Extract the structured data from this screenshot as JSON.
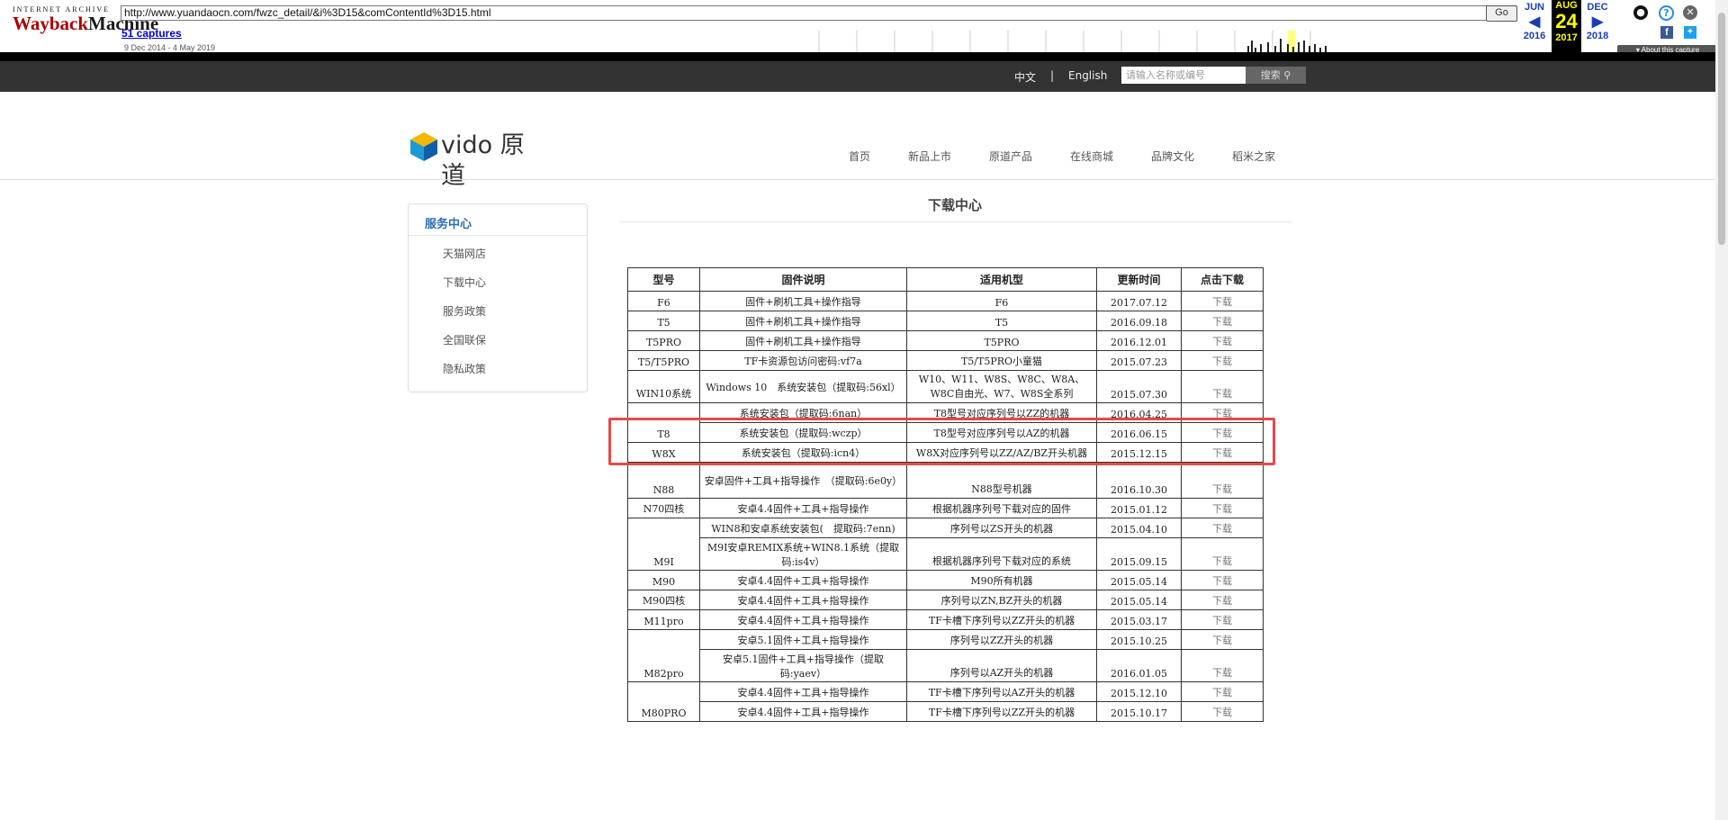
{
  "wayback": {
    "logo_top": "INTERNET ARCHIVE",
    "logo_main_a": "Wayback",
    "logo_main_b": "Machine",
    "url": "http://www.yuandaocn.com/fwzc_detail/&i%3D15&comContentId%3D15.html",
    "go_label": "Go",
    "captures": "51 captures",
    "range": "9 Dec 2014 - 4 May 2019",
    "prev_month": "JUN",
    "cur_month": "AUG",
    "next_month": "DEC",
    "prev_year": "2016",
    "cur_day": "24",
    "cur_year": "2017",
    "next_year": "2018",
    "about": "▾ About this capture"
  },
  "topbar": {
    "lang_cn": "中文",
    "sep": "|",
    "lang_en": "English",
    "search_placeholder": "请输入名称或编号",
    "search_btn": "搜索"
  },
  "header": {
    "logo_text": "vido 原道",
    "nav": [
      "首页",
      "新品上市",
      "原道产品",
      "在线商城",
      "品牌文化",
      "稻米之家"
    ]
  },
  "sidebar": {
    "title": "服务中心",
    "items": [
      "天猫网店",
      "下载中心",
      "服务政策",
      "全国联保",
      "隐私政策"
    ]
  },
  "content": {
    "title": "下载中心",
    "headers": [
      "型号",
      "固件说明",
      "适用机型",
      "更新时间",
      "点击下载"
    ],
    "rows": [
      {
        "model": "F6",
        "desc": "固件+刷机工具+操作指导",
        "device": "F6",
        "date": "2017.07.12",
        "dl": "下载"
      },
      {
        "model": "T5",
        "desc": "固件+刷机工具+操作指导",
        "device": "T5",
        "date": "2016.09.18",
        "dl": "下载"
      },
      {
        "model": "T5PRO",
        "desc": "固件+刷机工具+操作指导",
        "device": "T5PRO",
        "date": "2016.12.01",
        "dl": "下载"
      },
      {
        "model": "T5/T5PRO",
        "desc": "TF卡资源包访问密码:vf7a",
        "device": "T5/T5PRO小童猫",
        "date": "2015.07.23",
        "dl": "下载"
      },
      {
        "model": "WIN10系统",
        "desc": "Windows 10　系统安装包（提取码:56xl）",
        "device": "W10、W11、W8S、W8C、W8A、W8C自由光、W7、W8S全系列",
        "date": "2015.07.30",
        "dl": "下载"
      },
      {
        "model": "T8",
        "desc": "系统安装包（提取码:6nan）",
        "device": "T8型号对应序列号以ZZ的机器",
        "date": "2016.04.25",
        "dl": "下载"
      },
      {
        "model": "",
        "desc": "系统安装包（提取码:wczp）",
        "device": "T8型号对应序列号以AZ的机器",
        "date": "2016.06.15",
        "dl": "下载"
      },
      {
        "model": "W8X",
        "desc": "系统安装包（提取码:icn4）",
        "device": "W8X对应序列号以ZZ/AZ/BZ开头机器",
        "date": "2015.12.15",
        "dl": "下载"
      },
      {
        "model": "N88",
        "desc": "安卓固件+工具+指导操作　（提取码:6e0y）",
        "device": "N88型号机器",
        "date": "2016.10.30",
        "dl": "下载"
      },
      {
        "model": "N70四核",
        "desc": "安卓4.4固件+工具+指导操作",
        "device": "根据机器序列号下载对应的固件",
        "date": "2015.01.12",
        "dl": "下载"
      },
      {
        "model": "",
        "desc": "WIN8和安卓系统安装包(　提取码:7enn)",
        "device": "序列号以ZS开头的机器",
        "date": "2015.04.10",
        "dl": "下载"
      },
      {
        "model": "M9I",
        "desc": "M9I安卓REMIX系统+WIN8.1系统（提取码:is4v）",
        "device": "根据机器序列号下载对应的系统",
        "date": "2015.09.15",
        "dl": "下载"
      },
      {
        "model": "M90",
        "desc": "安卓4.4固件+工具+指导操作",
        "device": "M90所有机器",
        "date": "2015.05.14",
        "dl": "下载"
      },
      {
        "model": "M90四核",
        "desc": "安卓4.4固件+工具+指导操作",
        "device": "序列号以ZN,BZ开头的机器",
        "date": "2015.05.14",
        "dl": "下载"
      },
      {
        "model": "M11pro",
        "desc": "安卓4.4固件+工具+指导操作",
        "device": "TF卡槽下序列号以ZZ开头的机器",
        "date": "2015.03.17",
        "dl": "下载"
      },
      {
        "model": "",
        "desc": "安卓5.1固件+工具+指导操作",
        "device": "序列号以ZZ开头的机器",
        "date": "2015.10.25",
        "dl": "下载"
      },
      {
        "model": "M82pro",
        "desc": "安卓5.1固件+工具+指导操作（提取码:yaev）",
        "device": "序列号以AZ开头的机器",
        "date": "2016.01.05",
        "dl": "下载"
      },
      {
        "model": "",
        "desc": "安卓4.4固件+工具+指导操作",
        "device": "TF卡槽下序列号以AZ开头的机器",
        "date": "2015.12.10",
        "dl": "下载"
      },
      {
        "model": "M80PRO",
        "desc": "安卓4.4固件+工具+指导操作",
        "device": "TF卡槽下序列号以ZZ开头的机器",
        "date": "2015.10.17",
        "dl": "下载"
      }
    ]
  },
  "colors": {
    "accent_blue": "#2c6db8",
    "highlight_red": "#e74949",
    "topbar": "#333333"
  }
}
